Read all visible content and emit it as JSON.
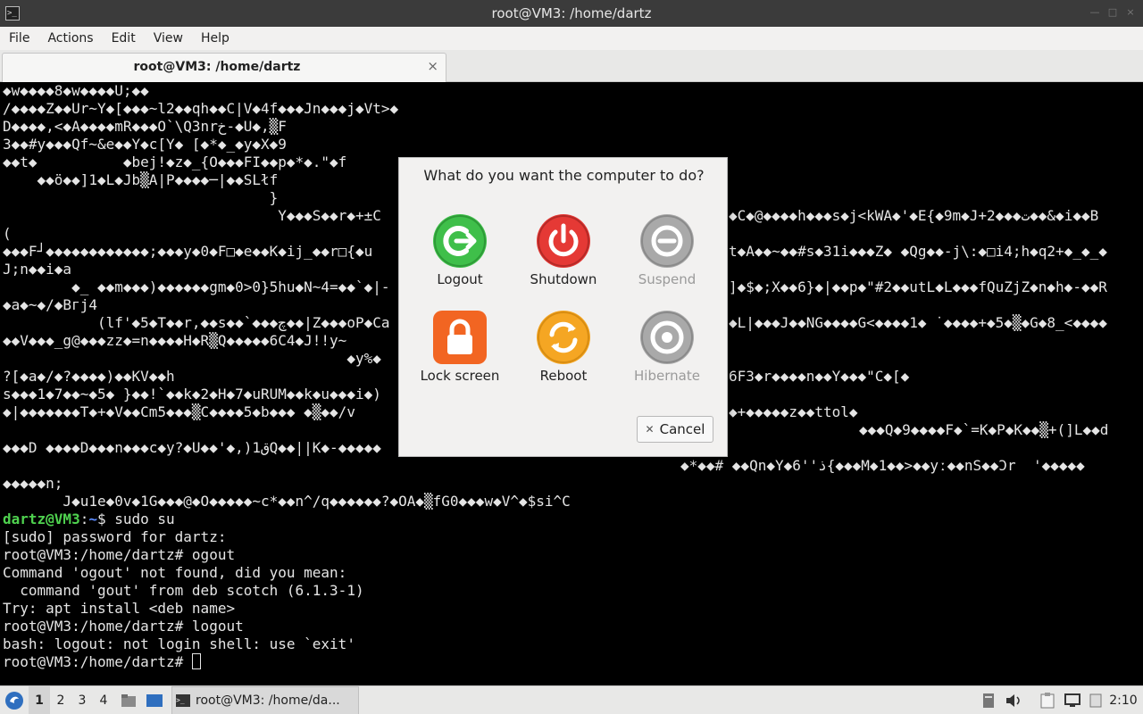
{
  "window": {
    "title": "root@VM3: /home/dartz"
  },
  "menu": [
    "File",
    "Actions",
    "Edit",
    "View",
    "Help"
  ],
  "tab": {
    "label": "root@VM3: /home/dartz",
    "close": "×"
  },
  "terminal": {
    "garbage": [
      "◆w◆◆◆◆8◆w◆◆◆◆U;◆◆",
      "/◆◆◆◆Z◆◆Ur~Y◆[◆◆◆~l2◆◆qh◆◆C|V◆4f◆◆◆Jn◆◆◆j◆Vt>◆",
      "D◆◆◆◆,<◆A◆◆◆◆mR◆◆◆O`\\Q3nrخ-◆U◆,▒F",
      "3◆◆#y◆◆◆Qf~&e◆◆Y◆c[Y◆ [◆*◆_◆y◆X◆9",
      "◆◆t◆          ◆bej!◆z◆_{O◆◆◆FI◆◆p◆*◆.\"◆f",
      "    ◆◆ö◆◆]1◆L◆Jb▒A|P◆◆◆◆─|◆◆SLłf",
      "                               }",
      "                                Y◆◆◆S◆◆r◆+±C",
      "(",
      "◆◆◆F┘◆◆◆◆◆◆◆◆◆◆◆◆;◆◆◆y◆0◆F□◆e◆◆K◆ij_◆◆r□{◆u",
      "J;n◆◆i◆a",
      "        ◆_ ◆◆m◆◆◆)◆◆◆◆◆◆gm◆0>0}5hu◆N~4=◆◆`◆|-",
      "◆a◆~◆/◆Bгj4",
      "           (lf'◆5◆T◆◆r,◆◆s◆◆`◆◆◆چ◆◆|Z◆◆◆oP◆Ca",
      "◆◆V◆◆◆_g@◆◆◆zz◆=n◆◆◆◆H◆R▒Q◆◆◆◆◆6C4◆J!!y~",
      "                                        ◆y%◆",
      "?[◆a◆/◆?◆◆◆◆)◆◆KV◆◆h",
      "s◆◆◆1◆7◆◆~◆5◆ }◆◆!`◆◆k◆2◆H◆7◆uRUM◆◆k◆u◆◆◆i◆)",
      "◆|◆◆◆◆◆◆◆T◆+◆V◆◆Cm5◆◆◆▒C◆◆◆◆5◆b◆◆◆ ◆▒◆◆/v",
      "",
      "◆◆◆D ◆◆◆◆D◆◆◆n◆◆◆c◆y?◆U◆◆'◆,)1قQ◆◆||K◆-◆◆◆◆◆",
      "",
      "◆◆◆◆◆n;",
      "       J◆u1e◆0v◆1G◆◆◆@◆O◆◆◆◆◆~c*◆◆n^/q◆◆◆◆◆◆?◆OA◆▒fG0◆◆◆w◆V^◆$si^C"
    ],
    "garbage_right": [
      "◆C◆@◆◆◆◆h◆◆◆s◆j<kWA◆'◆E{◆9m◆J+2◆◆◆ت◆◆&◆i◆◆B",
      "t◆A◆◆~◆◆#s◆31i◆◆◆Z◆ ◆Qg◆◆-j\\:◆□i4;h◆q2+◆_◆_◆",
      "]◆$◆;X◆◆6}◆|◆◆p◆\"#2◆◆utL◆L◆◆◆fQuZjZ◆n◆h◆-◆◆R",
      "◆L|◆◆◆J◆◆NG◆◆◆◆G<◆◆◆◆1◆ ˙◆◆◆◆+◆5◆▒◆G◆8_<◆◆◆◆",
      "6F3◆r◆◆◆◆n◆◆Y◆◆◆\"C◆[◆",
      "◆+◆◆◆◆◆z◆◆ttol◆",
      "◆◆◆Q◆9◆◆◆◆F◆`=K◆P◆K◆◆▒+(]L◆◆d",
      "◆*◆◆# ◆◆Qn◆Y◆6''ذ{◆◆◆M◆1◆◆>◆◆yː◆◆nS◆◆Ɔr  '◆◆◆◆◆"
    ],
    "session": [
      {
        "user": "dartz@VM3",
        "path": "~",
        "cmd": "$ sudo su"
      },
      {
        "text": "[sudo] password for dartz:"
      },
      {
        "text": "root@VM3:/home/dartz# ogout"
      },
      {
        "text": "Command 'ogout' not found, did you mean:"
      },
      {
        "text": "  command 'gout' from deb scotch (6.1.3-1)"
      },
      {
        "text": "Try: apt install <deb name>"
      },
      {
        "text": "root@VM3:/home/dartz# logout"
      },
      {
        "text": "bash: logout: not login shell: use `exit'"
      },
      {
        "text": "root@VM3:/home/dartz# "
      }
    ]
  },
  "dialog": {
    "question": "What do you want the computer to do?",
    "actions": [
      {
        "label": "Logout",
        "icon": "logout-icon",
        "color": "#3fbf4a",
        "enabled": true
      },
      {
        "label": "Shutdown",
        "icon": "power-icon",
        "color": "#e53935",
        "enabled": true
      },
      {
        "label": "Suspend",
        "icon": "suspend-icon",
        "color": "#a9a9a9",
        "enabled": false
      },
      {
        "label": "Lock screen",
        "icon": "lock-icon",
        "color": "#f26522",
        "enabled": true
      },
      {
        "label": "Reboot",
        "icon": "reboot-icon",
        "color": "#f5a623",
        "enabled": true
      },
      {
        "label": "Hibernate",
        "icon": "hibernate-icon",
        "color": "#a9a9a9",
        "enabled": false
      }
    ],
    "cancel_label": "Cancel"
  },
  "taskbar": {
    "workspaces": [
      "1",
      "2",
      "3",
      "4"
    ],
    "active_workspace": "1",
    "task_label": "root@VM3: /home/da...",
    "clock": "2:10"
  }
}
